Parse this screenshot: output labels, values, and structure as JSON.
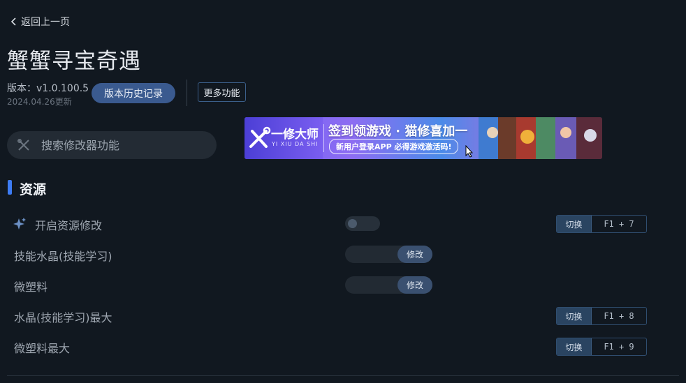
{
  "nav": {
    "back_label": "返回上一页"
  },
  "game": {
    "title": "蟹蟹寻宝奇遇",
    "version": "版本：v1.0.100.5",
    "updated": "2024.04.26更新"
  },
  "actions": {
    "history_label": "版本历史记录",
    "more_label": "更多功能"
  },
  "search": {
    "placeholder": "搜索修改器功能",
    "value": ""
  },
  "banner": {
    "brand": "一修大师",
    "brand_sub": "YI XIU DA SHI",
    "headline": "签到领游戏 · 猫修喜加一",
    "pill": "新用户登录APP  必得游戏激活码!"
  },
  "section": {
    "title": "资源"
  },
  "rows": [
    {
      "label": "开启资源修改",
      "control": "toggle",
      "enabled": false,
      "hotkey_action": "切换",
      "hotkey": "F1 + 7"
    },
    {
      "label": "技能水晶(技能学习)",
      "control": "numeric",
      "action_label": "修改"
    },
    {
      "label": "微塑料",
      "control": "numeric",
      "action_label": "修改"
    },
    {
      "label": "水晶(技能学习)最大",
      "control": "hotkey",
      "hotkey_action": "切换",
      "hotkey": "F1 + 8"
    },
    {
      "label": "微塑料最大",
      "control": "hotkey",
      "hotkey_action": "切换",
      "hotkey": "F1 + 9"
    }
  ],
  "colors": {
    "background": "#111820",
    "accent": "#3d7cf4",
    "button": "#3a5a8f"
  }
}
